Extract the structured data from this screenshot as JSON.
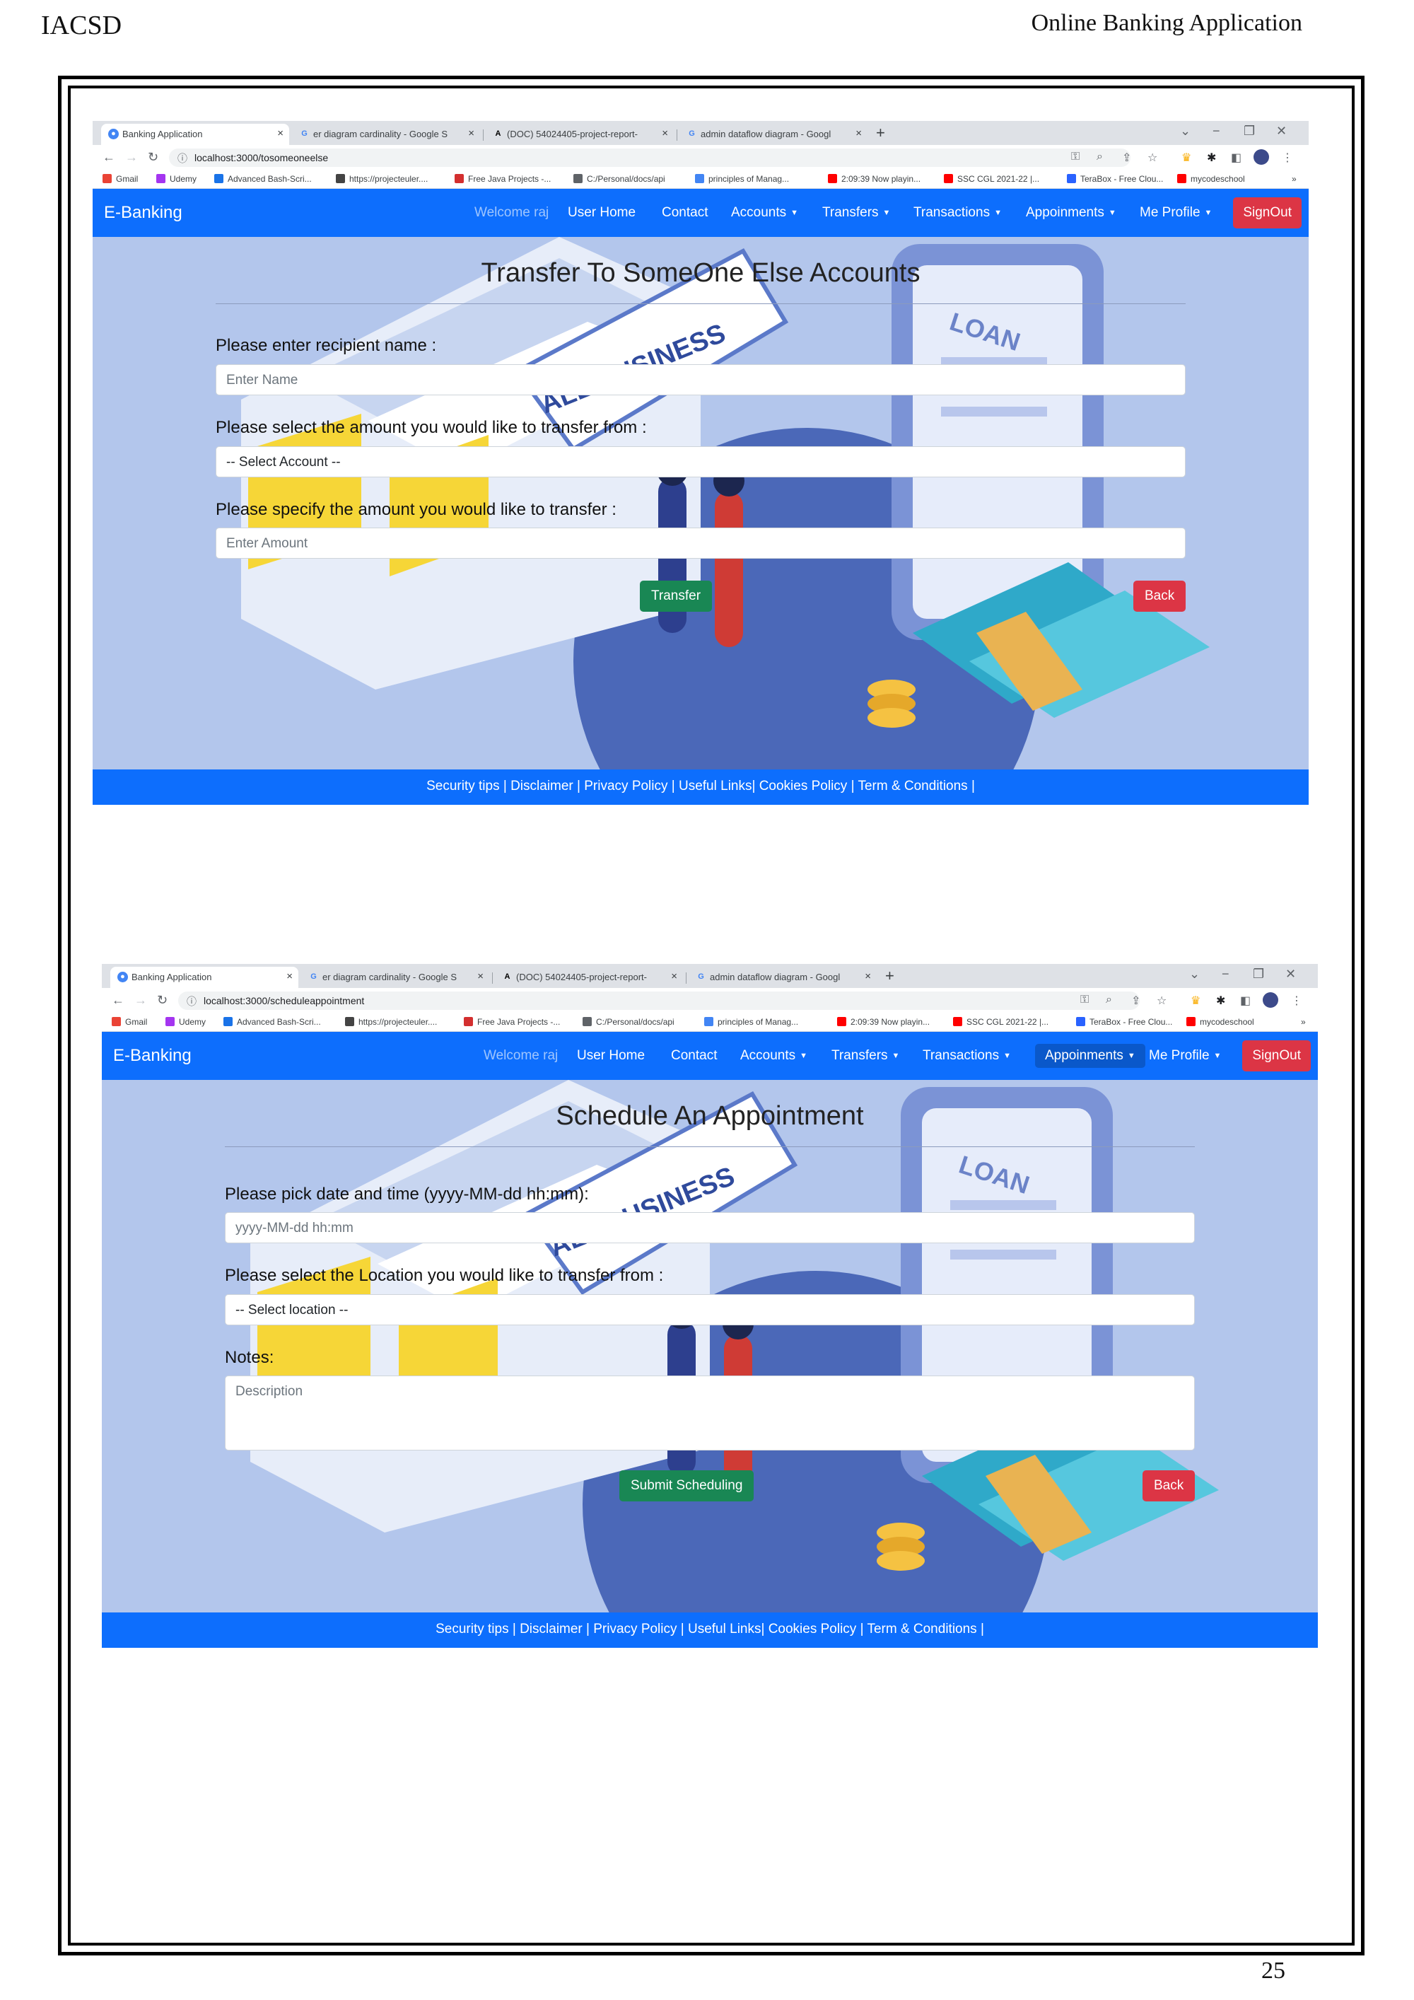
{
  "document": {
    "header_left": "IACSD",
    "header_right": "Online Banking Application",
    "page_number": "25"
  },
  "browser": {
    "tabs": [
      {
        "title": "Banking Application",
        "icon": "chrome-icon"
      },
      {
        "title": "er diagram cardinality - Google S",
        "icon": "google-icon"
      },
      {
        "title": "(DOC) 54024405-project-report-",
        "icon": "academia-icon"
      },
      {
        "title": "admin dataflow diagram - Googl",
        "icon": "google-icon"
      }
    ],
    "new_tab": "+",
    "bookmarks": [
      {
        "label": "Gmail",
        "color": "#ea4335"
      },
      {
        "label": "Udemy",
        "color": "#a435f0"
      },
      {
        "label": "Advanced Bash-Scri...",
        "color": "#1a73e8"
      },
      {
        "label": "https://projecteuler....",
        "color": "#444444"
      },
      {
        "label": "Free Java Projects -...",
        "color": "#d32f2f"
      },
      {
        "label": "C:/Personal/docs/api",
        "color": "#5f6368"
      },
      {
        "label": "principles of Manag...",
        "color": "#4285f4"
      },
      {
        "label": "2:09:39 Now playin...",
        "color": "#ff0000"
      },
      {
        "label": "SSC CGL 2021-22 |...",
        "color": "#ff0000"
      },
      {
        "label": "TeraBox - Free Clou...",
        "color": "#2962ff"
      },
      {
        "label": "mycodeschool",
        "color": "#ff0000"
      }
    ]
  },
  "app": {
    "brand": "E-Banking",
    "welcome": "Welcome raj",
    "nav": {
      "user_home": "User Home",
      "contact": "Contact",
      "accounts": "Accounts",
      "transfers": "Transfers",
      "transactions": "Transactions",
      "appointments": "Appoinments",
      "profile": "Me Profile"
    },
    "signout": "SignOut",
    "footer": "Security tips | Disclaimer | Privacy Policy | Useful Links| Cookies Policy | Term & Conditions |",
    "illustration": {
      "banner_text": "ALL BUSINESS",
      "phone_text": "LOAN"
    },
    "colors": {
      "primary": "#0d6efd",
      "success": "#198754",
      "danger": "#dc3545"
    }
  },
  "screen1": {
    "url": "localhost:3000/tosomeoneelse",
    "heading": "Transfer To SomeOne Else Accounts",
    "recipient_label": "Please enter recipient name :",
    "recipient_placeholder": "Enter Name",
    "account_label": "Please select the amount you would like to transfer from :",
    "account_select": "-- Select Account --",
    "amount_label": "Please specify the amount you would like to transfer :",
    "amount_placeholder": "Enter Amount",
    "submit": "Transfer",
    "back": "Back"
  },
  "screen2": {
    "url": "localhost:3000/scheduleappointment",
    "heading": "Schedule An Appointment",
    "date_label": "Please pick date and time (yyyy-MM-dd hh:mm):",
    "date_placeholder": "yyyy-MM-dd hh:mm",
    "location_label": "Please select the Location you would like to transfer from :",
    "location_select": "-- Select location --",
    "notes_label": "Notes:",
    "notes_placeholder": "Description",
    "submit": "Submit Scheduling",
    "back": "Back"
  }
}
